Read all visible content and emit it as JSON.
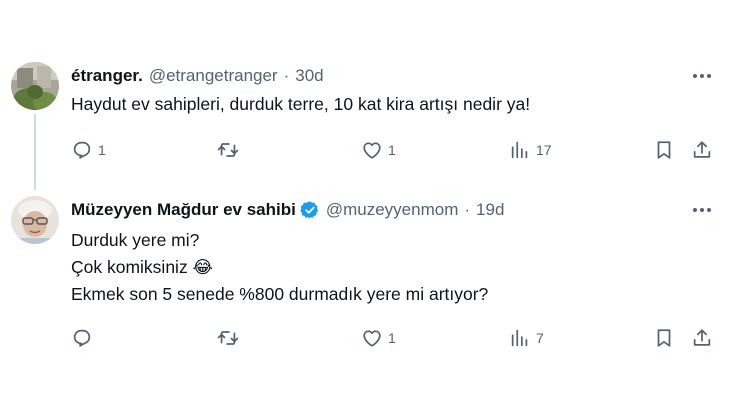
{
  "tweets": [
    {
      "name": "étranger.",
      "handle": "@etrangetranger",
      "time": "30d",
      "lines": [
        "Haydut ev sahipleri, durduk terre, 10 kat kira artışı nedir ya!"
      ],
      "replies": "1",
      "retweets": "",
      "likes": "1",
      "views": "17",
      "verified": false
    },
    {
      "name": "Müzeyyen Mağdur ev sahibi",
      "handle": "@muzeyyenmom",
      "time": "19d",
      "lines": [
        "Durduk yere mi?",
        "Çok komiksiniz 😂",
        "Ekmek son 5 senede %800 durmadık yere mi artıyor?"
      ],
      "replies": "",
      "retweets": "",
      "likes": "1",
      "views": "7",
      "verified": true
    }
  ],
  "separator": "·",
  "icons": {
    "reply": "reply-icon",
    "retweet": "retweet-icon",
    "like": "heart-icon",
    "views": "views-icon",
    "bookmark": "bookmark-icon",
    "share": "share-icon",
    "more": "more-icon",
    "verified": "verified-badge-icon"
  },
  "colors": {
    "verified": "#1d9bf0",
    "secondary_text": "#536471",
    "thread_line": "#cfd9de"
  }
}
